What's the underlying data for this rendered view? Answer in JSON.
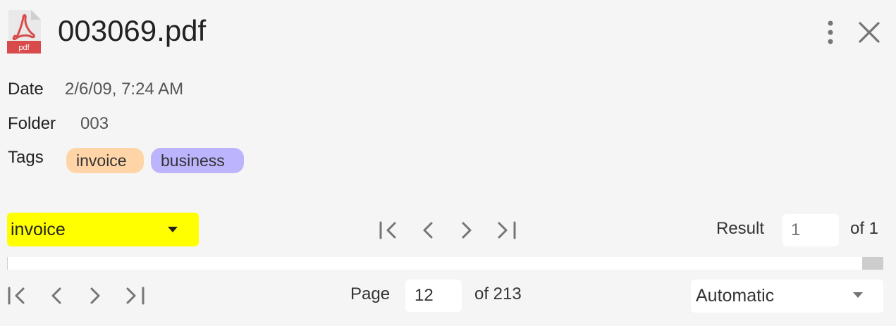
{
  "header": {
    "file_icon": "pdf-file-icon",
    "file_icon_text": "pdf",
    "title": "003069.pdf",
    "more_icon": "more-vertical-icon",
    "close_icon": "close-icon"
  },
  "meta": {
    "date_label": "Date",
    "date_value": "2/6/09, 7:24 AM",
    "folder_label": "Folder",
    "folder_value": "003",
    "tags_label": "Tags",
    "tags": [
      {
        "label": "invoice",
        "color": "#ffd5a8"
      },
      {
        "label": "business",
        "color": "#bcb4fc"
      }
    ]
  },
  "search": {
    "selected_value": "invoice",
    "highlight_color": "#ffff00",
    "nav_icons": [
      "first-result-icon",
      "previous-result-icon",
      "next-result-icon",
      "last-result-icon"
    ],
    "result_label": "Result",
    "result_input_placeholder": "1",
    "result_of": "of 1"
  },
  "pager": {
    "nav_icons": [
      "first-page-icon",
      "previous-page-icon",
      "next-page-icon",
      "last-page-icon"
    ],
    "page_label": "Page",
    "page_value": "12",
    "page_of": "of 213",
    "zoom_value": "Automatic"
  },
  "colors": {
    "background": "#f5f5f5",
    "pdf_red": "#d94a4a",
    "icon_gray": "#757575"
  }
}
